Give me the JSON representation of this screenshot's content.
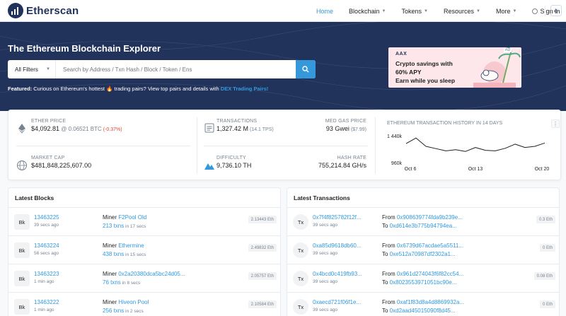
{
  "brand": {
    "name": "Etherscan"
  },
  "nav": {
    "home": "Home",
    "blockchain": "Blockchain",
    "tokens": "Tokens",
    "resources": "Resources",
    "more": "More",
    "sign_in": "Sign In"
  },
  "hero": {
    "title": "The Ethereum Blockchain Explorer",
    "filter_label": "All Filters",
    "search_placeholder": "Search by Address / Txn Hash / Block / Token / Ens",
    "featured_label": "Featured:",
    "featured_text": " Curious on Ethereum's hottest 🔥 trading pairs? View top pairs and details with ",
    "featured_link": "DEX Trading Pairs!"
  },
  "ad": {
    "brand": "AAX",
    "tag": "Ad",
    "line1": "Crypto savings with",
    "line2": "60% APY",
    "line3": "Earn while you sleep"
  },
  "stats": {
    "ether_price_label": "ETHER PRICE",
    "ether_price": "$4,092.81",
    "ether_btc": " @ 0.06521 BTC",
    "ether_change": " (-0.37%)",
    "market_cap_label": "MARKET CAP",
    "market_cap": "$481,848,225,607.00",
    "transactions_label": "TRANSACTIONS",
    "transactions": "1,327.42 M",
    "tps": " (14.1 TPS)",
    "gas_label": "MED GAS PRICE",
    "gas": "93 Gwei",
    "gas_usd": " ($7.99)",
    "difficulty_label": "DIFFICULTY",
    "difficulty": "9,736.10 TH",
    "hashrate_label": "HASH RATE",
    "hashrate": "755,214.84 GH/s"
  },
  "chart_data": {
    "type": "line",
    "title": "ETHEREUM TRANSACTION HISTORY IN 14 DAYS",
    "y_ticks": [
      "1 440k",
      "960k"
    ],
    "x_ticks": [
      "Oct 6",
      "Oct 13",
      "Oct 20"
    ],
    "ylim": [
      960000,
      1440000
    ],
    "x": [
      1,
      2,
      3,
      4,
      5,
      6,
      7,
      8,
      9,
      10,
      11,
      12,
      13,
      14,
      15
    ],
    "values": [
      1300000,
      1400000,
      1250000,
      1210000,
      1170000,
      1190000,
      1160000,
      1230000,
      1180000,
      1170000,
      1215000,
      1290000,
      1230000,
      1250000,
      1310000
    ],
    "grid": false,
    "legend": "none"
  },
  "colors": {
    "primary": "#3498db",
    "navy": "#21325b",
    "negative": "#de4437",
    "muted": "#77838f"
  },
  "blocks": {
    "title": "Latest Blocks",
    "items": [
      {
        "badge": "Bk",
        "number": "13463225",
        "time": "39 secs ago",
        "miner_label": "Miner ",
        "miner": "F2Pool Old",
        "txns": "213 txns",
        "txn_time": " in 17 secs",
        "reward": "2.13443 Eth"
      },
      {
        "badge": "Bk",
        "number": "13463224",
        "time": "56 secs ago",
        "miner_label": "Miner ",
        "miner": "Ethermine",
        "txns": "438 txns",
        "txn_time": " in 15 secs",
        "reward": "2.49832 Eth"
      },
      {
        "badge": "Bk",
        "number": "13463223",
        "time": "1 min ago",
        "miner_label": "Miner ",
        "miner": "0x2a20380dca5bc24d05...",
        "txns": "76 txns",
        "txn_time": " in 8 secs",
        "reward": "2.05757 Eth"
      },
      {
        "badge": "Bk",
        "number": "13463222",
        "time": "1 min ago",
        "miner_label": "Miner ",
        "miner": "Hiveon Pool",
        "txns": "256 txns",
        "txn_time": " in 2 secs",
        "reward": "2.10584 Eth"
      }
    ]
  },
  "txs": {
    "title": "Latest Transactions",
    "items": [
      {
        "badge": "Tx",
        "hash": "0x7f4f825782f12f...",
        "time": "39 secs ago",
        "from_label": "From ",
        "from": "0x908639774fda9b239e...",
        "to_label": "To ",
        "to": "0xd614e3b775b94794ea...",
        "value": "0.3 Eth"
      },
      {
        "badge": "Tx",
        "hash": "0xa85d9618db60...",
        "time": "39 secs ago",
        "from_label": "From ",
        "from": "0x6739d67acdae5a5511...",
        "to_label": "To ",
        "to": "0xe512a70987df2302a1...",
        "value": "0 Eth"
      },
      {
        "badge": "Tx",
        "hash": "0x4bcd0c419fb93...",
        "time": "39 secs ago",
        "from_label": "From ",
        "from": "0x961d274043f6f82cc54...",
        "to_label": "To ",
        "to": "0x8023553971051bc90e...",
        "value": "0.08 Eth"
      },
      {
        "badge": "Tx",
        "hash": "0xaecd721f06f1e...",
        "time": "39 secs ago",
        "from_label": "From ",
        "from": "0xaf1f83d8a4d8869932a...",
        "to_label": "To ",
        "to": "0xd2aad45015090f8d45...",
        "value": "0 Eth"
      }
    ]
  }
}
